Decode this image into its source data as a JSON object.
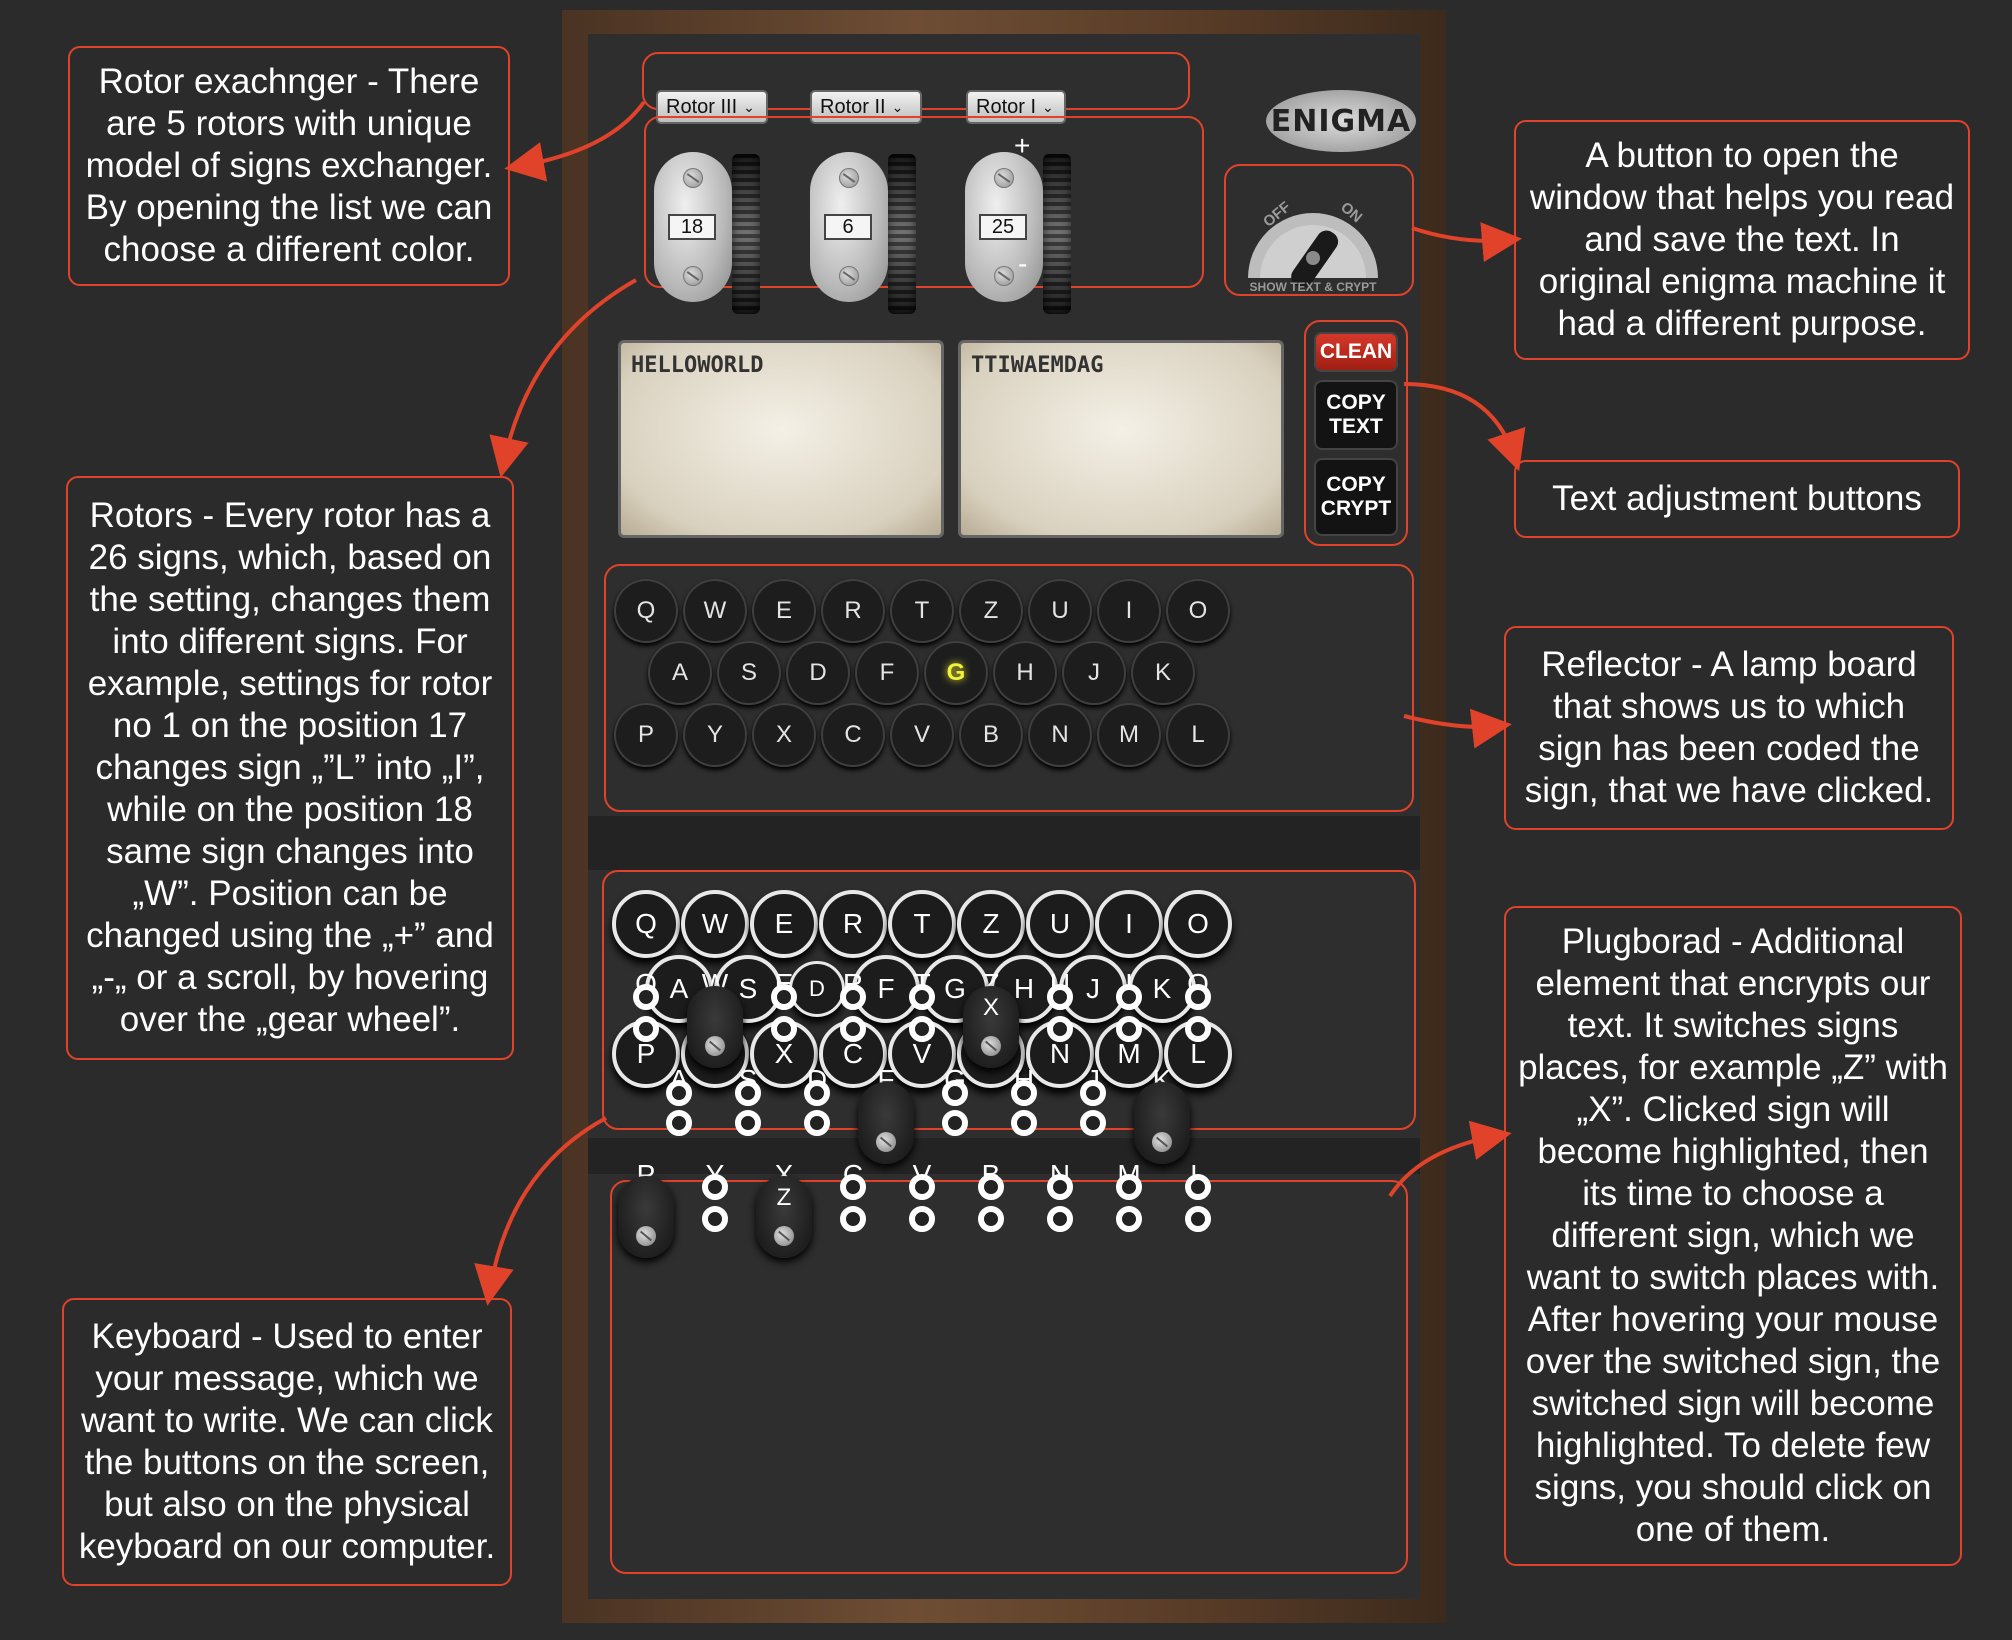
{
  "annotations": {
    "rotor_exchanger": "Rotor exachnger - There are 5 rotors with unique model of signs exchanger. By opening the list we can choose a different color.",
    "rotors": "Rotors - Every rotor has a 26 signs, which, based on the setting, changes them into different signs. For example, settings for rotor no 1 on the position 17 changes sign „”L” into „I”, while on the position 18 same sign changes into „W”. Position can be changed using the „+” and „-„ or a scroll, by hovering over the „gear wheel”.",
    "keyboard": "Keyboard - Used to enter your message, which we want to write. We can click the buttons on the screen, but also on the physical keyboard on our computer.",
    "show_button": "A button to open the window that helps you read and save the text. In original enigma machine it had a different purpose.",
    "text_buttons": "Text adjustment buttons",
    "reflector": "Reflector - A lamp board that shows us to which sign has been coded the sign, that we have clicked.",
    "plugboard": "Plugborad - Additional element that encrypts our text. It switches signs places, for example „Z” with „X”. Clicked sign will become highlighted, then its time to choose a different sign, which we want to switch places with. After hovering your mouse over the switched sign, the switched sign will become highlighted. To delete few signs, you should click on one of them."
  },
  "machine": {
    "logo": "ENIGMA",
    "rotor_selects": [
      "Rotor III",
      "Rotor II",
      "Rotor I"
    ],
    "rotor_positions": [
      "18",
      "6",
      "25"
    ],
    "plus": "+",
    "minus": "-",
    "switch": {
      "off": "OFF",
      "on": "ON",
      "label": "SHOW TEXT & CRYPT"
    },
    "input_text": "HELLOWORLD",
    "output_text": "TTIWAEMDAG",
    "buttons": {
      "clean": "CLEAN",
      "copy_text": "COPY TEXT",
      "copy_crypt": "COPY CRYPT"
    },
    "rows": [
      [
        "Q",
        "W",
        "E",
        "R",
        "T",
        "Z",
        "U",
        "I",
        "O"
      ],
      [
        "A",
        "S",
        "D",
        "F",
        "G",
        "H",
        "J",
        "K"
      ],
      [
        "P",
        "Y",
        "X",
        "C",
        "V",
        "B",
        "N",
        "M",
        "L"
      ]
    ],
    "lit_lamp": "G",
    "pressed_key": "D",
    "plugs": [
      {
        "from": "W",
        "to": "",
        "row": 0
      },
      {
        "from": "Z",
        "to": "X",
        "row": 0
      },
      {
        "from": "F",
        "to": "",
        "row": 1
      },
      {
        "from": "K",
        "to": "",
        "row": 1
      },
      {
        "from": "P",
        "to": "",
        "row": 2
      },
      {
        "from": "X",
        "to": "Z",
        "row": 2
      }
    ]
  },
  "colors": {
    "accent": "#e0432a",
    "background": "#2b2b2b",
    "lamp_lit": "#f2f23a"
  }
}
